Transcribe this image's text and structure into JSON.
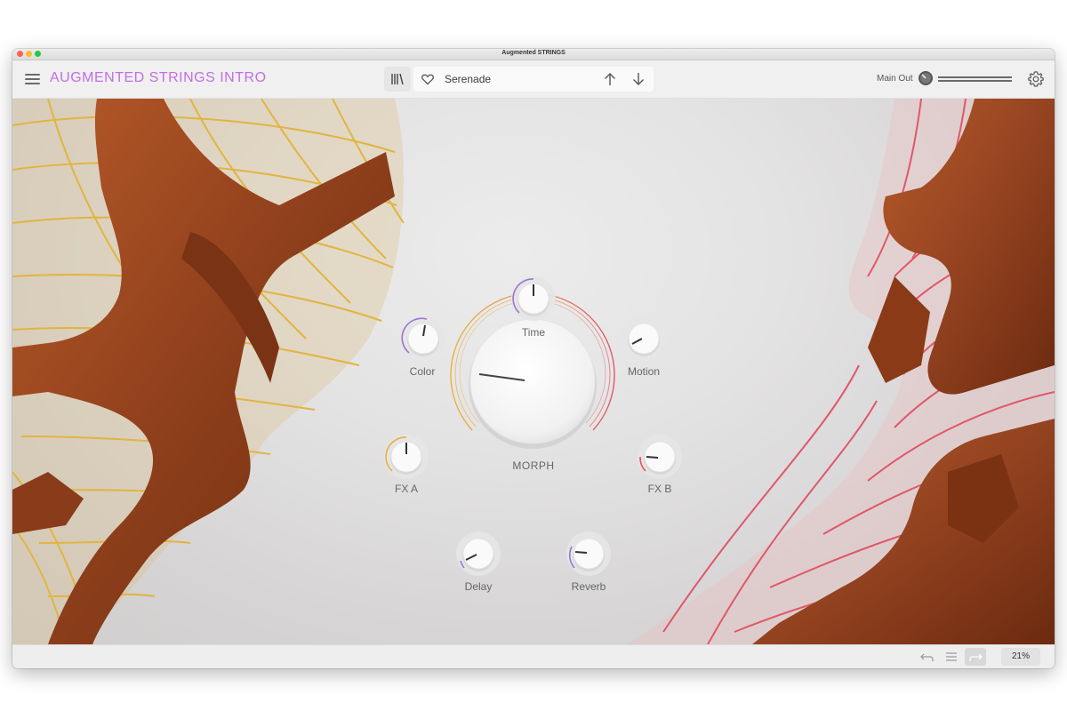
{
  "window": {
    "title": "Augmented STRINGS"
  },
  "header": {
    "menu_icon": "hamburger-menu-icon",
    "preset_title": "AUGMENTED STRINGS INTRO",
    "library_icon": "library-icon",
    "favorite_icon": "heart-icon",
    "preset_name": "Serenade",
    "prev_icon": "arrow-up-icon",
    "next_icon": "arrow-down-icon",
    "main_out_label": "Main Out",
    "settings_icon": "gear-icon"
  },
  "colors": {
    "accent": "#c36ee6",
    "left_strings": "#e2b440",
    "right_strings": "#e0576a",
    "wood": "#9a4a22"
  },
  "knobs": {
    "time": {
      "label": "Time"
    },
    "color": {
      "label": "Color"
    },
    "motion": {
      "label": "Motion"
    },
    "fx_a": {
      "label": "FX A"
    },
    "fx_b": {
      "label": "FX B"
    },
    "delay": {
      "label": "Delay"
    },
    "reverb": {
      "label": "Reverb"
    },
    "morph": {
      "label": "MORPH"
    }
  },
  "footer": {
    "undo_icon": "undo-icon",
    "history_icon": "list-icon",
    "redo_icon": "redo-icon",
    "zoom": "21%"
  }
}
